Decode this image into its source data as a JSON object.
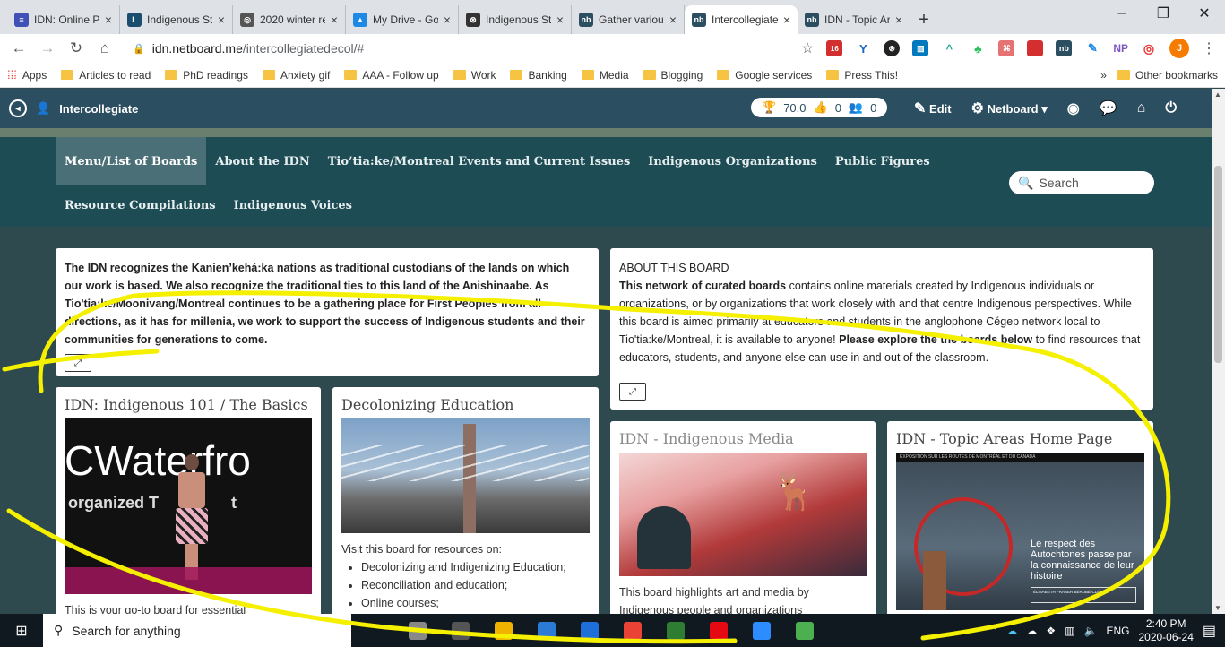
{
  "browser": {
    "tabs": [
      {
        "title": "IDN: Online Pr",
        "color": "#3f51b5",
        "glyph": "≡"
      },
      {
        "title": "Indigenous Stu",
        "color": "#1b4d6e",
        "glyph": "L"
      },
      {
        "title": "2020 winter re",
        "color": "#555555",
        "glyph": "◎"
      },
      {
        "title": "My Drive - Go",
        "color": "#1e88e5",
        "glyph": "▲"
      },
      {
        "title": "Indigenous Stu",
        "color": "#333333",
        "glyph": "⊗"
      },
      {
        "title": "Gather various",
        "color": "#2c4e61",
        "glyph": "nb"
      },
      {
        "title": "Intercollegiate",
        "color": "#2c4e61",
        "glyph": "nb",
        "active": true
      },
      {
        "title": "IDN - Topic Ar",
        "color": "#2c4e61",
        "glyph": "nb"
      }
    ],
    "url_host": "idn.netboard.me",
    "url_path": "/intercollegiatedecol/#",
    "profile_initial": "J",
    "bookmarks": [
      "Articles to read",
      "PhD readings",
      "Anxiety gif",
      "AAA - Follow up",
      "Work",
      "Banking",
      "Media",
      "Blogging",
      "Google services",
      "Press This!"
    ],
    "apps_label": "Apps",
    "other_bookmarks": "Other bookmarks",
    "ext_badge": "16",
    "ext_np": "NP"
  },
  "header": {
    "title": "Intercollegiate",
    "points": "70.0",
    "likes": "0",
    "followers": "0",
    "edit_label": "Edit",
    "netboard_label": "Netboard"
  },
  "menu": {
    "row1": [
      "Menu/List of Boards",
      "About the IDN",
      "Tio’tia:ke/Montreal Events and Current Issues",
      "Indigenous Organizations",
      "Public Figures"
    ],
    "row2": [
      "Resource Compilations",
      "Indigenous Voices"
    ],
    "search_placeholder": "Search"
  },
  "cards": {
    "land": {
      "text": "The IDN recognizes the Kanien’kehá:ka nations as traditional custodians of the lands on which our work is based. We also recognize the traditional ties to this land of the Anishinaabe. As Tio'tia:ke/Moonivang/Montreal continues to be a gathering place for First Peoples from all directions, as it has for millenia, we work to support the success of Indigenous students and their communities for generations to come."
    },
    "about": {
      "heading": "ABOUT THIS BOARD",
      "lead": "This network of curated boards",
      "body1": " contains online materials created by Indigenous individuals or organizations, or by organizations that work closely with and that centre Indigenous perspectives. While this board is aimed primarily at educators and students in the anglophone Cégep network local to Tio'tia:ke/Montreal, it is available to anyone! ",
      "bold2": "Please explore the the boards below",
      "body2": " to find resources that educators, students, and anyone else can use in and out of the classroom."
    },
    "idn101": {
      "title": "IDN: Indigenous 101 / The Basics",
      "image_text_big": "CWaterfro",
      "image_text_small": "organized T",
      "image_text_small2": "t",
      "desc": "This is your go-to board for essential"
    },
    "decol": {
      "title": "Decolonizing Education",
      "desc_intro": "Visit this board for resources on:",
      "bullets": [
        "Decolonizing and Indigenizing Education;",
        "Reconciliation and education;",
        "Online courses;"
      ]
    },
    "media": {
      "title": "IDN - Indigenous Media",
      "desc": "This board highlights art and media by Indigenous people and organizations"
    },
    "topic": {
      "title": "IDN - Topic Areas Home Page",
      "img_header": "EXPOSITION  SUR LES ROUTES DE MONTRÉAL ET DU CANADA",
      "img_caption": "Le respect des Autochtones passe par la connaissance de leur histoire",
      "img_box": "ÉLISABETH FRASER BÉRUBÉ-CLÉARY"
    }
  },
  "taskbar": {
    "search_placeholder": "Search for anything",
    "time": "2:40 PM",
    "date": "2020-06-24",
    "lang": "ENG",
    "apps": [
      "#888888",
      "#555555",
      "#f0b400",
      "#2b7bd6",
      "#1e6fd9",
      "#ea4335",
      "#2e7d32",
      "#e50914",
      "#2d8cff",
      "#4caf50"
    ]
  },
  "colors": {
    "header_bg": "#2c4e61",
    "banner_bg": "#1e4c55",
    "content_bg": "#2f4a4f",
    "annotation": "#f5f000"
  }
}
